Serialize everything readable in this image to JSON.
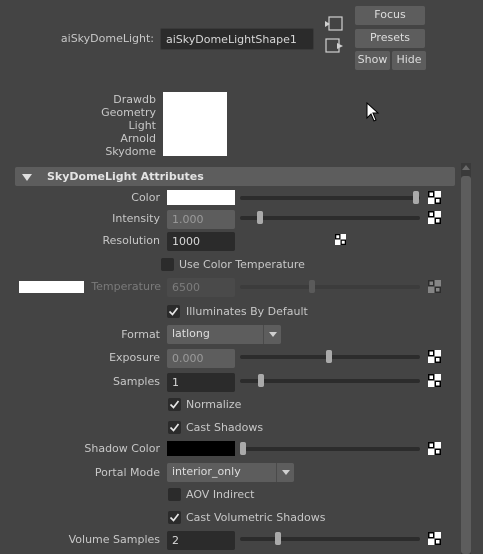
{
  "header": {
    "node_type_label": "aiSkyDomeLight:",
    "node_name": "aiSkyDomeLightShape1",
    "focus_label": "Focus",
    "presets_label": "Presets",
    "show_label": "Show",
    "hide_label": "Hide"
  },
  "swatch_tags": [
    "Drawdb",
    "Geometry",
    "Light",
    "Arnold",
    "Skydome"
  ],
  "section": {
    "title": "SkyDomeLight Attributes"
  },
  "attributes": {
    "color": {
      "label": "Color",
      "swatch_color": "#ffffff",
      "slider_value": 1.0
    },
    "intensity": {
      "label": "Intensity",
      "value": "1.000",
      "slider_value": 0.1
    },
    "resolution": {
      "label": "Resolution",
      "value": "1000"
    },
    "use_color_temperature": {
      "label": "Use Color Temperature",
      "checked": false
    },
    "temperature": {
      "label": "Temperature",
      "value": "6500",
      "swatch_color": "#ffffff",
      "slider_value": 0.5
    },
    "illuminates_by_default": {
      "label": "Illuminates By Default",
      "checked": true
    },
    "format": {
      "label": "Format",
      "value": "latlong"
    },
    "exposure": {
      "label": "Exposure",
      "value": "0.000",
      "slider_value": 0.5
    },
    "samples": {
      "label": "Samples",
      "value": "1",
      "slider_value": 0.1
    },
    "normalize": {
      "label": "Normalize",
      "checked": true
    },
    "cast_shadows": {
      "label": "Cast Shadows",
      "checked": true
    },
    "shadow_color": {
      "label": "Shadow Color",
      "swatch_color": "#000000",
      "slider_value": 0.0
    },
    "portal_mode": {
      "label": "Portal Mode",
      "value": "interior_only"
    },
    "aov_indirect": {
      "label": "AOV Indirect",
      "checked": false
    },
    "cast_volumetric_shadows": {
      "label": "Cast Volumetric Shadows",
      "checked": true
    },
    "volume_samples": {
      "label": "Volume Samples",
      "value": "2",
      "slider_value": 0.2
    }
  },
  "colors": {
    "panel_bg": "#444444",
    "field_bg": "#2b2b2b",
    "section_header_bg": "#5d5d5d",
    "scrollbar_bg": "#5d5d5d"
  }
}
